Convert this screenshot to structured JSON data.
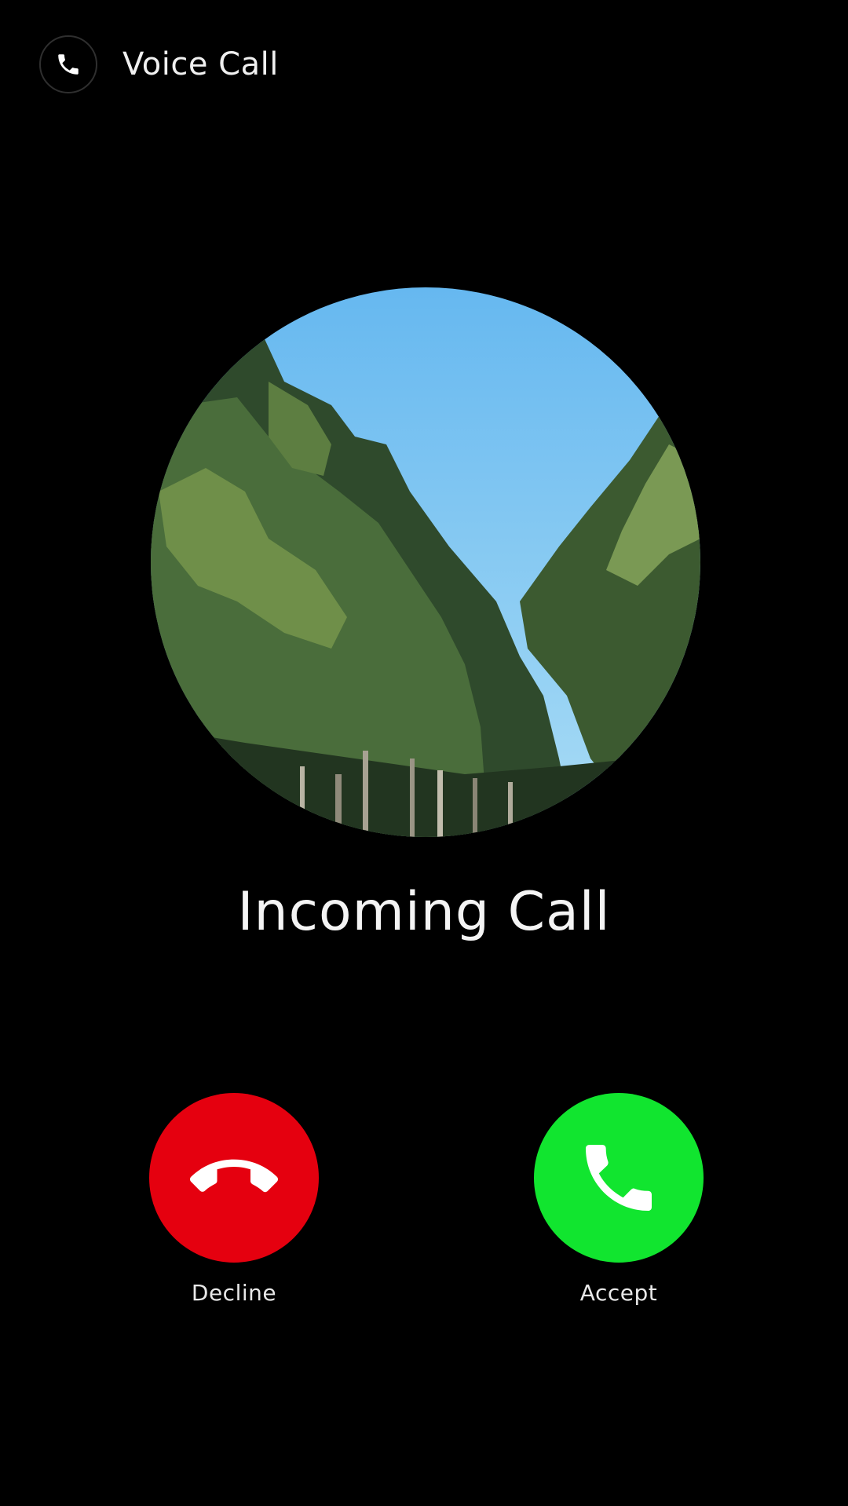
{
  "header": {
    "title": "Voice Call",
    "icon": "phone-icon"
  },
  "caller": {
    "avatar": "tree-canopy-photo",
    "status": "Incoming Call"
  },
  "actions": {
    "decline": {
      "label": "Decline",
      "color": "#e5000f",
      "icon": "phone-hangup-icon"
    },
    "accept": {
      "label": "Accept",
      "color": "#11e52f",
      "icon": "phone-accept-icon"
    }
  },
  "colors": {
    "background": "#000000",
    "text": "#ffffff"
  }
}
